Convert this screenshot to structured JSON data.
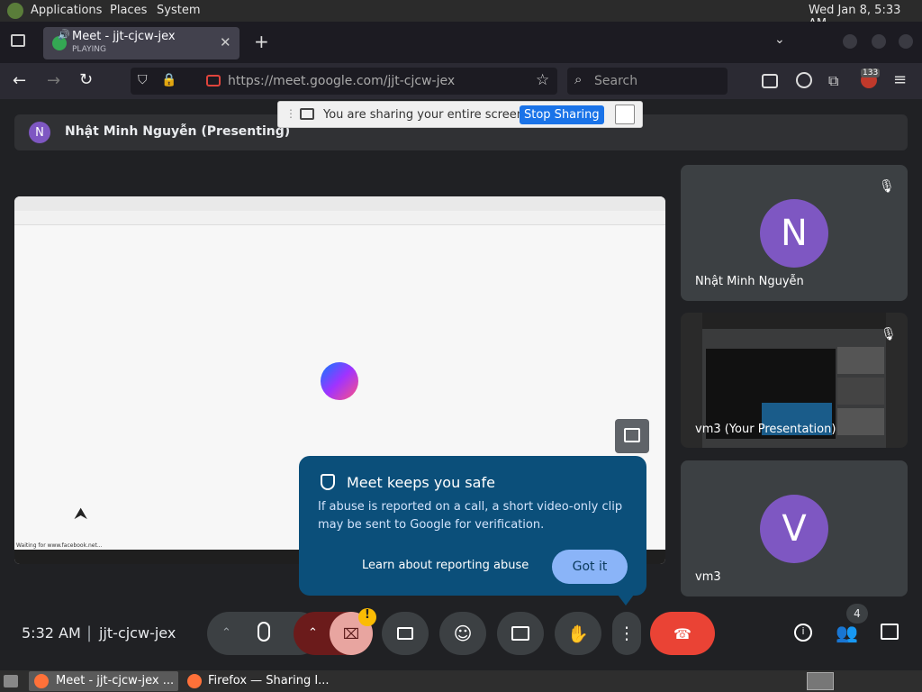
{
  "panel": {
    "applications": "Applications",
    "places": "Places",
    "system": "System",
    "clock": "Wed Jan  8,  5:33 AM"
  },
  "browser": {
    "tab": {
      "title": "Meet - jjt-cjcw-jex",
      "status": "PLAYING"
    },
    "url": "https://meet.google.com/jjt-cjcw-jex",
    "url_host": "meet.google.com",
    "search_placeholder": "Search",
    "extension_badge": "133"
  },
  "sharing_bar": {
    "message": "You are sharing your entire screen.",
    "stop_label": "Stop Sharing"
  },
  "presenter_banner": {
    "initial": "N",
    "name": "Nhật Minh Nguyễn (Presenting)"
  },
  "participants": [
    {
      "initial": "N",
      "name": "Nhật Minh Nguyễn",
      "muted": true,
      "avatar_color": "#7e57c2"
    },
    {
      "name": "vm3 (Your Presentation)",
      "muted": true
    },
    {
      "initial": "V",
      "name": "vm3",
      "avatar_color": "#7e57c2"
    }
  ],
  "shared_screen": {
    "status_text": "Waiting for www.facebook.net..."
  },
  "safety_popup": {
    "title": "Meet keeps you safe",
    "body": "If abuse is reported on a call, a short video-only clip may be sent to Google for verification.",
    "learn_link": "Learn about reporting abuse",
    "got_it": "Got it"
  },
  "controls": {
    "time": "5:32 AM",
    "meeting_code": "jjt-cjcw-jex",
    "participant_count": "4"
  },
  "taskbar": {
    "item1": "Meet - jjt-cjcw-jex ...",
    "item2": "Firefox — Sharing I..."
  },
  "colors": {
    "meet_bg": "#202124",
    "tile_bg": "#3c4043",
    "popup_bg": "#0b4f7a",
    "popup_button": "#8ab4f8",
    "end_call": "#ea4335",
    "stop_sharing": "#1a73e8",
    "avatar": "#7e57c2"
  }
}
